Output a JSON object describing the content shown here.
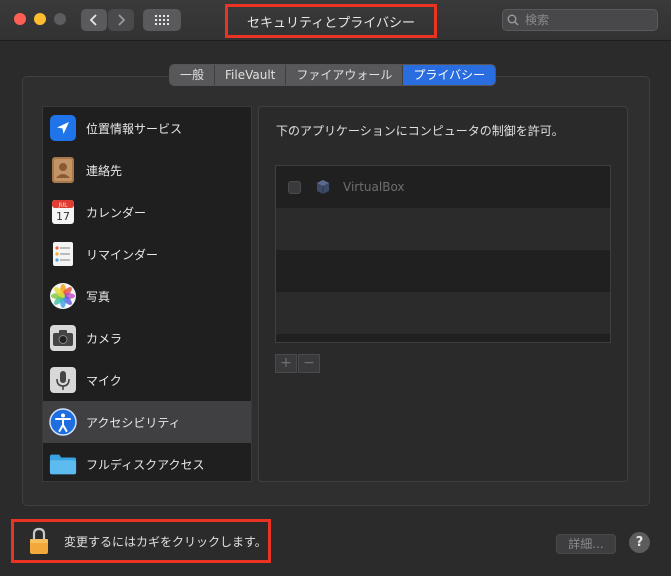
{
  "window": {
    "title": "セキュリティとプライバシー",
    "search_placeholder": "検索"
  },
  "tabs": [
    {
      "label": "一般",
      "active": false
    },
    {
      "label": "FileVault",
      "active": false
    },
    {
      "label": "ファイアウォール",
      "active": false
    },
    {
      "label": "プライバシー",
      "active": true
    }
  ],
  "sidebar": {
    "items": [
      {
        "label": "位置情報サービス",
        "icon": "location-icon"
      },
      {
        "label": "連絡先",
        "icon": "contacts-icon"
      },
      {
        "label": "カレンダー",
        "icon": "calendar-icon",
        "calendar_month": "JUL",
        "calendar_day": "17"
      },
      {
        "label": "リマインダー",
        "icon": "reminders-icon"
      },
      {
        "label": "写真",
        "icon": "photos-icon"
      },
      {
        "label": "カメラ",
        "icon": "camera-icon"
      },
      {
        "label": "マイク",
        "icon": "microphone-icon"
      },
      {
        "label": "アクセシビリティ",
        "icon": "accessibility-icon",
        "selected": true
      },
      {
        "label": "フルディスクアクセス",
        "icon": "folder-icon"
      }
    ]
  },
  "main": {
    "description": "下のアプリケーションにコンピュータの制御を許可。",
    "apps": [
      {
        "name": "VirtualBox",
        "checked": false,
        "icon": "virtualbox-icon"
      }
    ],
    "add_label": "+",
    "remove_label": "−"
  },
  "footer": {
    "lock_text": "変更するにはカギをクリックします。",
    "details_label": "詳細...",
    "help_label": "?"
  },
  "colors": {
    "accent": "#2a6de0",
    "highlight_box": "#ea3323"
  }
}
